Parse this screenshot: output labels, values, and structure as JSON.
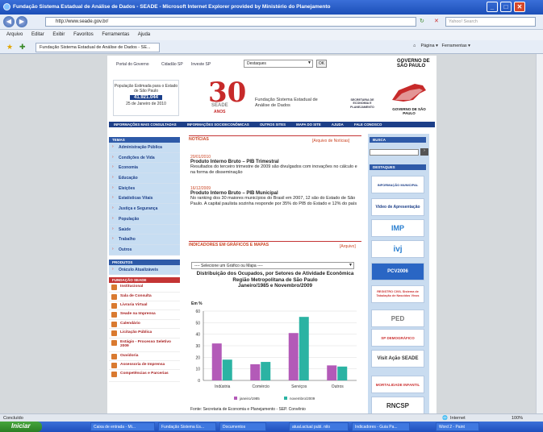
{
  "browser": {
    "title": "Fundação Sistema Estadual de Análise de Dados - SEADE - Microsoft Internet Explorer provided by Ministério do Planejamento",
    "address": "http://www.seade.gov.br/",
    "search_placeholder": "Yahoo! Search",
    "menu": [
      "Arquivo",
      "Editar",
      "Exibir",
      "Favoritos",
      "Ferramentas",
      "Ajuda"
    ],
    "tab_title": "Fundação Sistema Estadual de Análise de Dados - SE...",
    "tools": {
      "page": "Página",
      "tools": "Ferramentas"
    },
    "status_left": "Concluído",
    "status_zone": "Internet",
    "zoom": "100%"
  },
  "taskbar": {
    "start": "Iniciar",
    "tasks": [
      "Caixa de entrada - Mi...",
      "Fundação Sistema Es...",
      "Documentos",
      "atual.actual publ. nilo",
      "Indicadores - Guia Pa...",
      "Word 2 - Paint"
    ]
  },
  "site": {
    "toplinks": [
      "Portal do Governo",
      "Cidadão SP",
      "Investe SP"
    ],
    "destaques_label": "Destaques",
    "ok_label": "OK",
    "gov_logo": "GOVERNO DE SÃO PAULO",
    "population": {
      "label": "População Estimada para o Estado de São Paulo",
      "value": "41.921.044",
      "date": "25 de Janeiro de 2010"
    },
    "anniversary": {
      "number": "30",
      "brand": "SEADE",
      "anos": "ANOS"
    },
    "org_name": "Fundação Sistema Estadual de Análise de Dados",
    "secretaria": "SECRETARIA DE ECONOMIA E PLANEJAMENTO",
    "nav": [
      "INFORMAÇÕES MAIS CONSULTADAS",
      "INFORMAÇÕES SOCIOECONÔMICAS",
      "OUTROS SITES",
      "MAPA DO SITE",
      "AJUDA",
      "FALE CONOSCO"
    ],
    "temas_header": "TEMAS",
    "temas": [
      "Administração Pública",
      "Condições de Vida",
      "Economia",
      "Educação",
      "Eleições",
      "Estatísticas Vitais",
      "Justiça e Segurança",
      "População",
      "Saúde",
      "Trabalho",
      "Outros"
    ],
    "produtos_header": "PRODUTOS",
    "produtos": [
      "Oráculo Atualizáveis"
    ],
    "fundacao_header": "FUNDAÇÃO SEADE",
    "fundacao": [
      "Institucional",
      "Sala de Consulta",
      "Livraria Virtual",
      "Seade na Imprensa",
      "Calendário",
      "Licitação Pública",
      "Estágio - Processo Seletivo 2009",
      "Ouvidoria",
      "Assessoria de Imprensa",
      "Competências e Parcerias"
    ],
    "noticias_header": "NOTÍCIAS",
    "arquivo_noticias": "[Arquivo de Notícias]",
    "news": [
      {
        "date": "20/01/2010",
        "title": "Produto Interno Bruto – PIB Trimestral",
        "text": "Resultados do terceiro trimestre de 2009 são divulgados com inovações no cálculo e na forma de disseminação"
      },
      {
        "date": "16/12/2009",
        "title": "Produto Interno Bruto – PIB Municipal",
        "text": "No ranking dos 30 maiores municípios do Brasil em 2007, 12 são do Estado de São Paulo. A capital paulista sozinha responde por 35% do PIB do Estado e 12% do país"
      }
    ],
    "indicadores_header": "INDICADORES EM GRÁFICOS E MAPAS",
    "arquivo": "[Arquivo]",
    "select_label": "---- Selecione um Gráfico ou Mapa ----",
    "busca_header": "BUSCA",
    "destaques_header": "DESTAQUES",
    "right_boxes": [
      "INFORMAÇÃO MUNICIPAL",
      "Vídeo de Apresentação",
      "IMP",
      "ivj",
      "PCV2006",
      "REGISTRO CIVIL Sistema de Tabulação de Nascidos Vivos",
      "PED",
      "SP DEMOGRÁFICO",
      "Visit Ação SEADE",
      "MORTALIDADE INFANTIL",
      "RNCSP"
    ],
    "fonte": "Fonte: Secretaria de Economia e Planejamento - SEP. Convênio"
  },
  "chart_data": {
    "type": "bar",
    "title": "Distribuição dos Ocupados, por Setores de Atividade Econômica",
    "subtitle": "Região Metropolitana de São Paulo",
    "period": "Janeiro/1985 e Novembro/2009",
    "ylabel": "Em %",
    "ylim": [
      0,
      60
    ],
    "yticks": [
      0,
      10,
      20,
      30,
      40,
      50,
      60
    ],
    "categories": [
      "Indústria",
      "Comércio",
      "Serviços",
      "Outros"
    ],
    "series": [
      {
        "name": "janeiro/1985",
        "color": "#b35ab8",
        "values": [
          32,
          14,
          41,
          13
        ]
      },
      {
        "name": "novembro/2009",
        "color": "#2bb3a3",
        "values": [
          18,
          16,
          55,
          12
        ]
      }
    ]
  }
}
